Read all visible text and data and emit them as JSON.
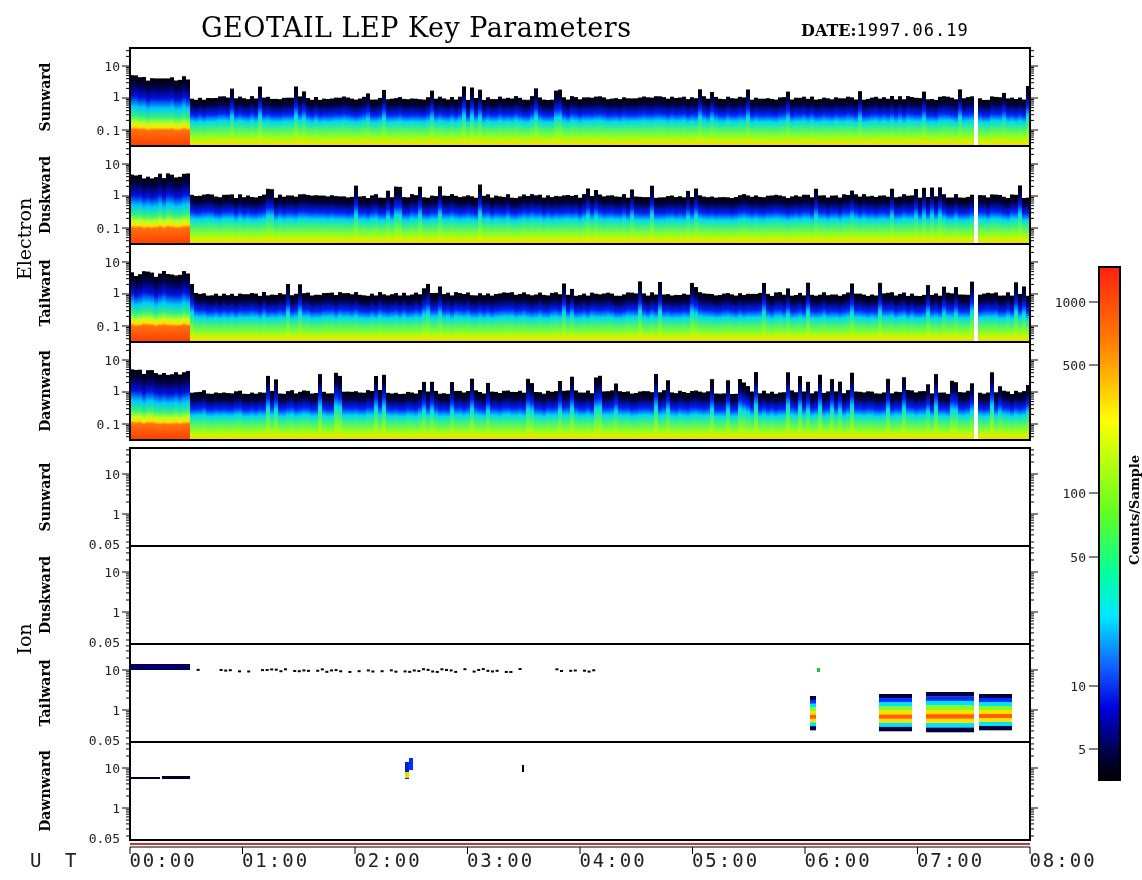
{
  "title": "GEOTAIL LEP Key Parameters",
  "date": {
    "label": "DATE:",
    "value": "1997.06.19"
  },
  "groups": [
    {
      "name": "Electron",
      "panels": [
        {
          "direction": "Sunward",
          "kind": "spectrogram",
          "yticks": [
            "10",
            "1",
            "0.1"
          ]
        },
        {
          "direction": "Duskward",
          "kind": "spectrogram",
          "yticks": [
            "10",
            "1",
            "0.1"
          ]
        },
        {
          "direction": "Tailward",
          "kind": "spectrogram",
          "yticks": [
            "10",
            "1",
            "0.1"
          ]
        },
        {
          "direction": "Dawnward",
          "kind": "spectrogram",
          "yticks": [
            "10",
            "1",
            "0.1"
          ]
        }
      ]
    },
    {
      "name": "Ion",
      "panels": [
        {
          "direction": "Sunward",
          "kind": "empty",
          "yticks": [
            "10",
            "1",
            "0.05"
          ]
        },
        {
          "direction": "Duskward",
          "kind": "empty",
          "yticks": [
            "10",
            "1",
            "0.05"
          ]
        },
        {
          "direction": "Tailward",
          "kind": "sparse",
          "yticks": [
            "10",
            "1",
            "0.05"
          ]
        },
        {
          "direction": "Dawnward",
          "kind": "blips",
          "yticks": [
            "10",
            "1",
            "0.05"
          ]
        }
      ]
    }
  ],
  "colorbar": {
    "label": "Counts/Sample",
    "ticks": [
      "1000",
      "500",
      "100",
      "50",
      "10",
      "5"
    ]
  },
  "time_axis": {
    "label": "U T",
    "ticks": [
      "00:00",
      "01:00",
      "02:00",
      "03:00",
      "04:00",
      "05:00",
      "06:00",
      "07:00",
      "08:00"
    ]
  }
}
